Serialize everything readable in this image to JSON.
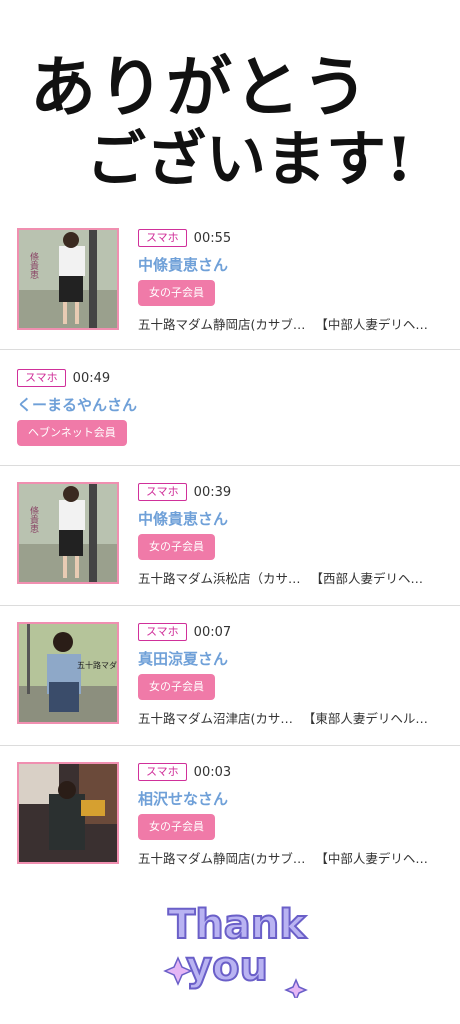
{
  "header": {
    "text": "ありがとうございます!"
  },
  "entries": [
    {
      "device": "スマホ",
      "time": "00:55",
      "name": "中條貴恵さん",
      "member_type": "女の子会員",
      "shop": "五十路マダム静岡店(カサブ…",
      "area": "【中部人妻デリヘ…",
      "photo_text": "條貴恵"
    },
    {
      "device": "スマホ",
      "time": "00:49",
      "name": "くーまるやんさん",
      "member_type": "ヘブンネット会員"
    },
    {
      "device": "スマホ",
      "time": "00:39",
      "name": "中條貴恵さん",
      "member_type": "女の子会員",
      "shop": "五十路マダム浜松店（カサ…",
      "area": "【西部人妻デリヘ…",
      "photo_text": "條貴恵"
    },
    {
      "device": "スマホ",
      "time": "00:07",
      "name": "真田涼夏さん",
      "member_type": "女の子会員",
      "shop": "五十路マダム沼津店(カサ…",
      "area": "【東部人妻デリヘル…",
      "photo_text": "五十路マダム"
    },
    {
      "device": "スマホ",
      "time": "00:03",
      "name": "相沢せなさん",
      "member_type": "女の子会員",
      "shop": "五十路マダム静岡店(カサブ…",
      "area": "【中部人妻デリヘ…"
    }
  ],
  "footer": {
    "text": "Thank you"
  },
  "colors": {
    "accent_pink": "#f07aa8",
    "name_blue": "#6fa0d8",
    "device_magenta": "#d0309a"
  }
}
